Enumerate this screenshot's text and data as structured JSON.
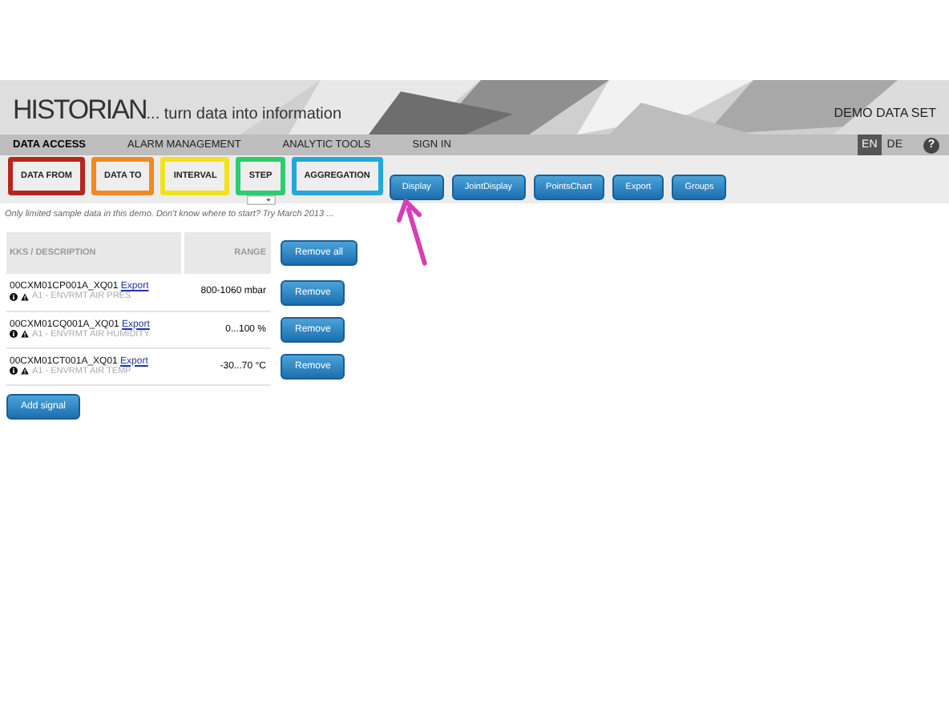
{
  "header": {
    "brand": "HISTORIAN",
    "tagline": "... turn data into information",
    "dataset": "DEMO DATA SET"
  },
  "nav": {
    "items": [
      {
        "label": "DATA ACCESS",
        "selected": true
      },
      {
        "label": "ALARM MANAGEMENT",
        "selected": false
      },
      {
        "label": "ANALYTIC TOOLS",
        "selected": false
      },
      {
        "label": "SIGN IN",
        "selected": false
      }
    ],
    "languages": [
      {
        "label": "EN",
        "selected": true
      },
      {
        "label": "DE",
        "selected": false
      }
    ],
    "help": "?"
  },
  "filters": [
    {
      "label": "DATA FROM",
      "color": "#b5261e"
    },
    {
      "label": "DATA TO",
      "color": "#f08a24"
    },
    {
      "label": "INTERVAL",
      "color": "#f2e21b"
    },
    {
      "label": "STEP",
      "color": "#2ecc71"
    },
    {
      "label": "AGGREGATION",
      "color": "#22a8dd"
    }
  ],
  "actions": [
    "Display",
    "JointDisplay",
    "PointsChart",
    "Export",
    "Groups"
  ],
  "hint": "Only limited sample data in this demo. Don't know where to start? Try March 2013 ...",
  "table": {
    "columns": [
      "KKS / DESCRIPTION",
      "RANGE"
    ],
    "remove_all": "Remove all",
    "rows": [
      {
        "kks": "00CXM01CP001A_XQ01",
        "link": "Export",
        "desc": "A1 - ENVRMT AIR PRES",
        "range": "800-1060 mbar",
        "action": "Remove"
      },
      {
        "kks": "00CXM01CQ001A_XQ01",
        "link": "Export",
        "desc": "A1 - ENVRMT AIR HUMIDITY",
        "range": "0...100 %",
        "action": "Remove"
      },
      {
        "kks": "00CXM01CT001A_XQ01",
        "link": "Export",
        "desc": "A1 - ENVRMT AIR TEMP",
        "range": "-30...70 °C",
        "action": "Remove"
      }
    ]
  },
  "add_signal": "Add signal"
}
